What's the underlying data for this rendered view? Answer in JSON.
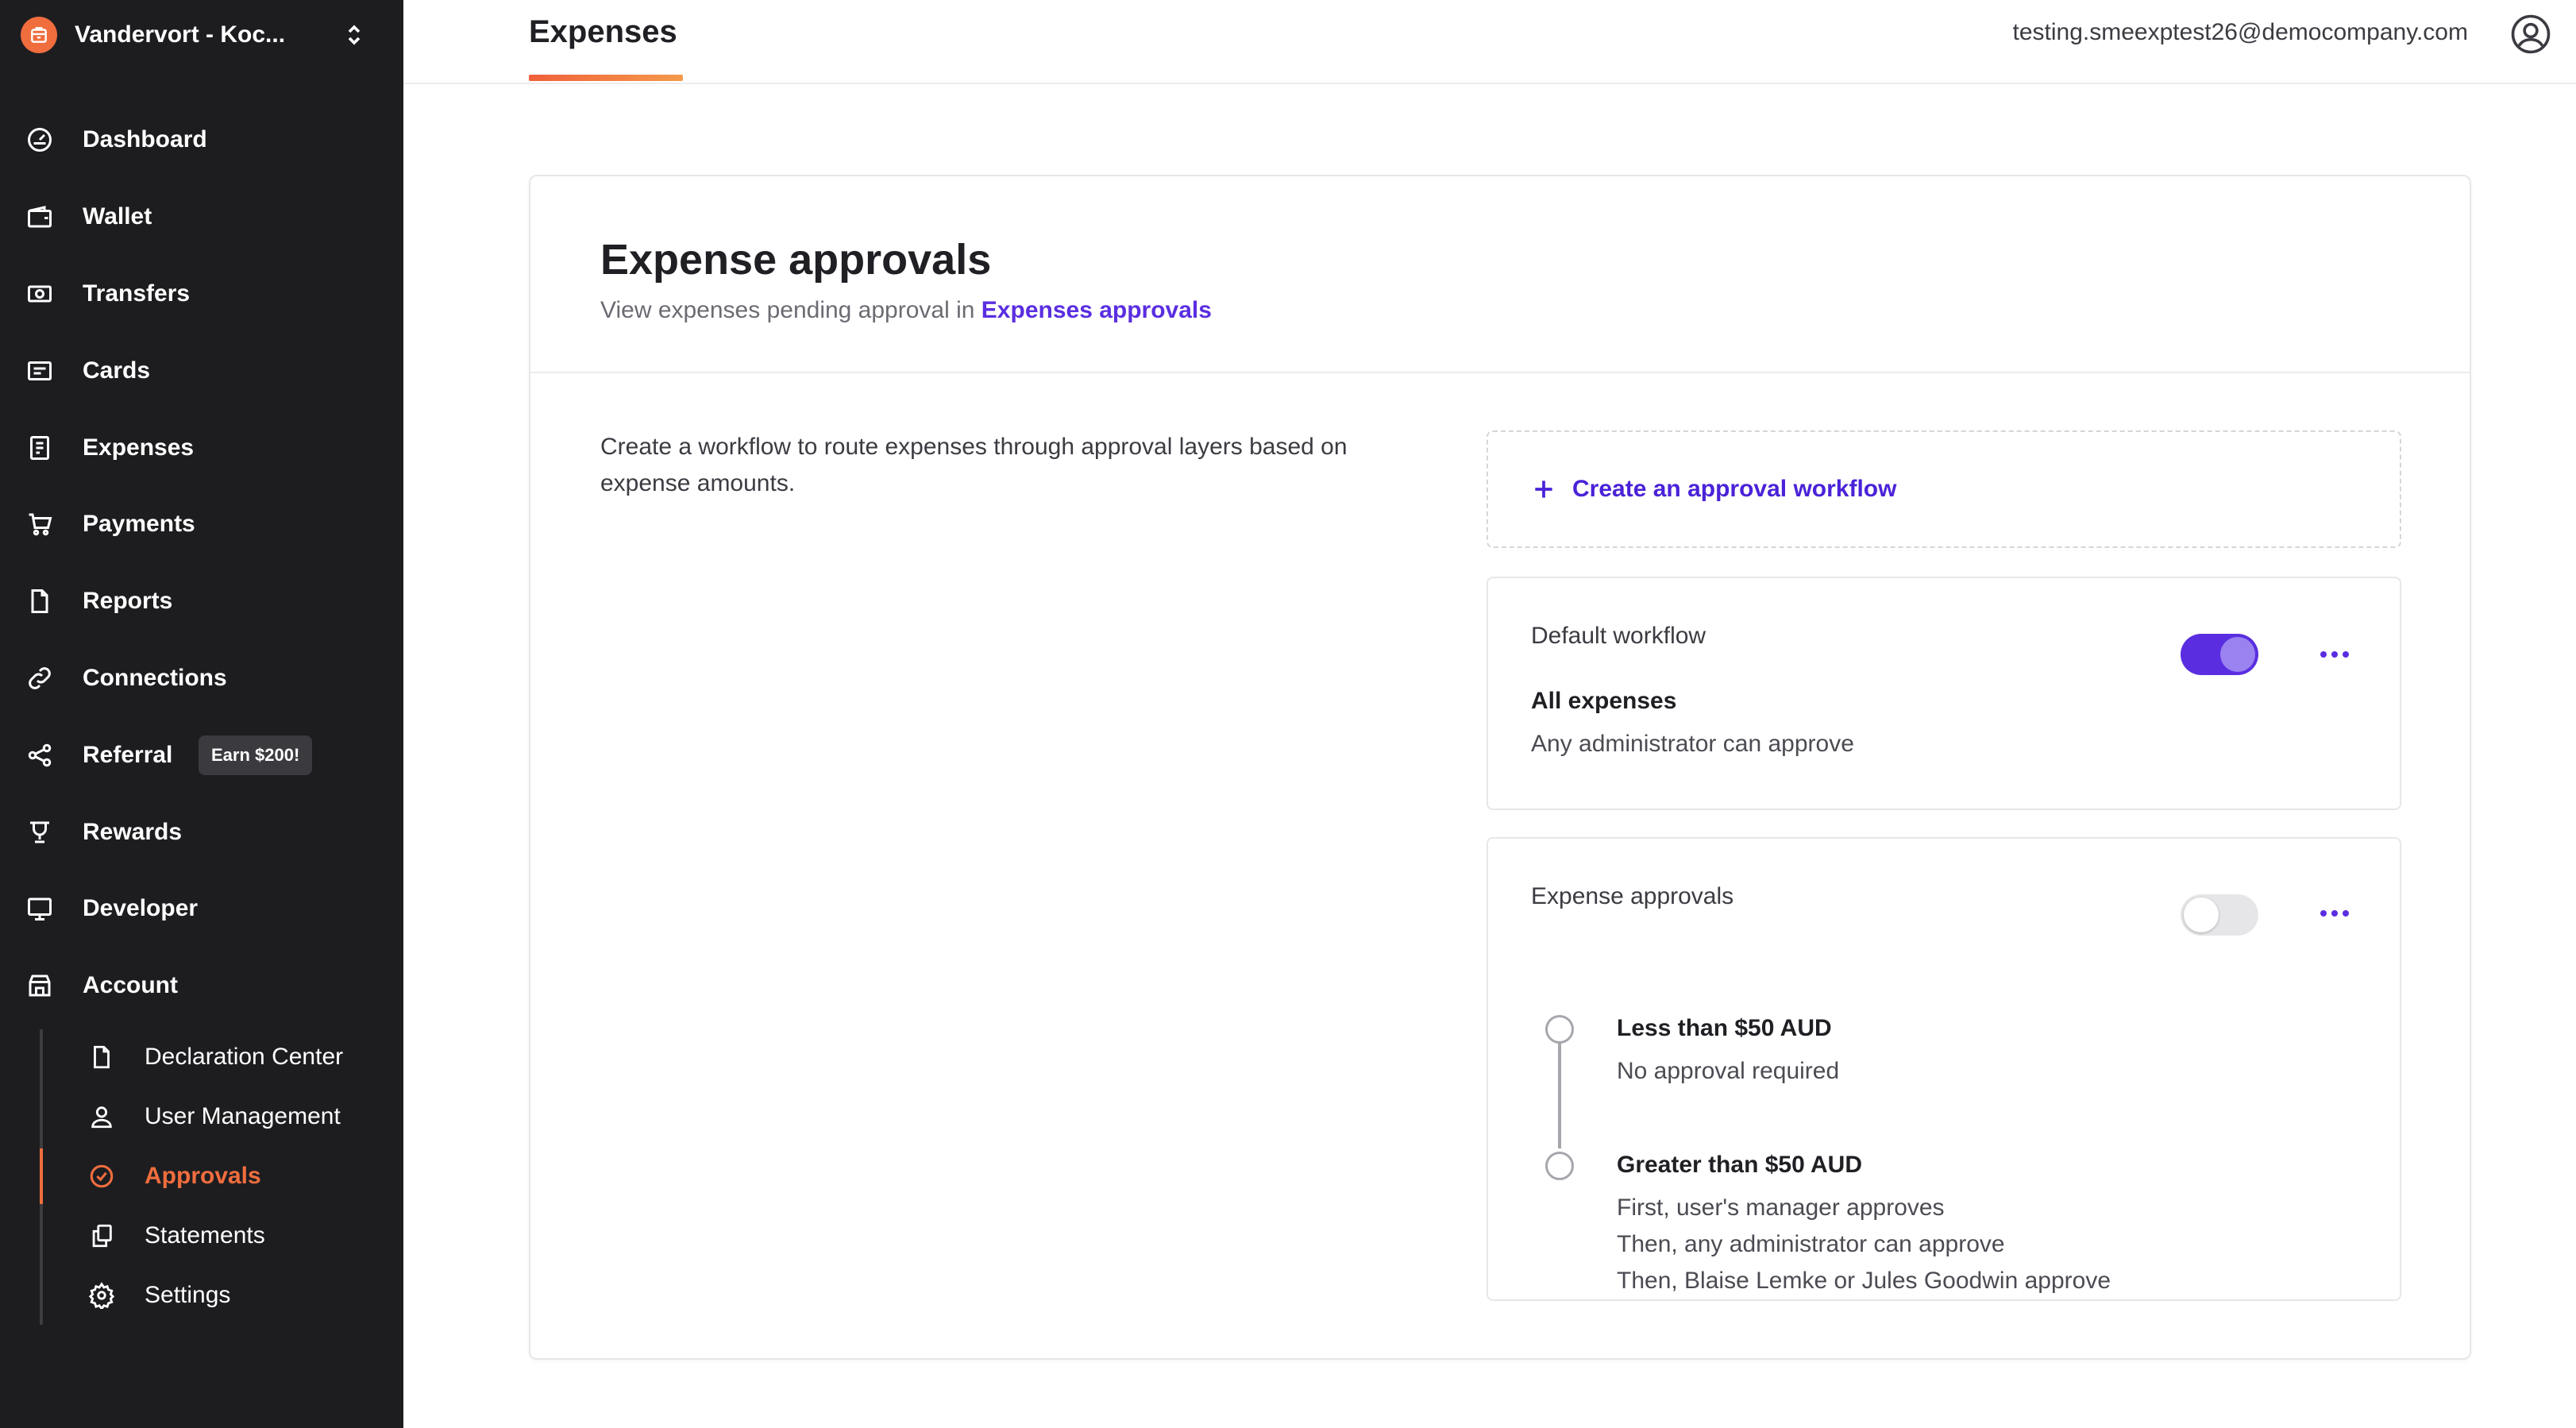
{
  "sidebar": {
    "org_name": "Vandervort - Koc...",
    "nav": [
      {
        "label": "Dashboard",
        "icon": "dashboard-gauge-icon"
      },
      {
        "label": "Wallet",
        "icon": "wallet-icon"
      },
      {
        "label": "Transfers",
        "icon": "transfers-cash-icon"
      },
      {
        "label": "Cards",
        "icon": "card-icon"
      },
      {
        "label": "Expenses",
        "icon": "receipt-icon"
      },
      {
        "label": "Payments",
        "icon": "cart-icon"
      },
      {
        "label": "Reports",
        "icon": "document-icon"
      },
      {
        "label": "Connections",
        "icon": "link-icon"
      },
      {
        "label": "Referral",
        "icon": "share-icon",
        "badge": "Earn $200!"
      },
      {
        "label": "Rewards",
        "icon": "trophy-icon"
      },
      {
        "label": "Developer",
        "icon": "monitor-icon"
      },
      {
        "label": "Account",
        "icon": "store-icon"
      }
    ],
    "account_sub": [
      {
        "label": "Declaration Center",
        "icon": "file-icon"
      },
      {
        "label": "User Management",
        "icon": "user-icon"
      },
      {
        "label": "Approvals",
        "icon": "check-circle-icon",
        "active": true
      },
      {
        "label": "Statements",
        "icon": "copy-icon"
      },
      {
        "label": "Settings",
        "icon": "gear-icon"
      }
    ]
  },
  "header": {
    "tab": "Expenses",
    "email": "testing.smeexptest26@democompany.com"
  },
  "main": {
    "title": "Expense approvals",
    "subtitle_prefix": "View expenses pending approval in",
    "subtitle_link": "Expenses approvals",
    "description": "Create a workflow to route expenses through approval layers based on expense amounts.",
    "create_label": "Create an approval workflow",
    "workflows": [
      {
        "name": "Default workflow",
        "enabled": true,
        "rule_title": "All expenses",
        "rule_text": "Any administrator can approve"
      },
      {
        "name": "Expense approvals",
        "enabled": false,
        "steps": [
          {
            "title": "Less than $50 AUD",
            "lines": [
              "No approval required"
            ]
          },
          {
            "title": "Greater than $50 AUD",
            "lines": [
              "First, user's manager approves",
              "Then, any administrator can approve",
              "Then, Blaise Lemke or Jules Goodwin approve"
            ]
          }
        ]
      }
    ]
  },
  "colors": {
    "sidebar_bg": "#1d1d20",
    "accent_orange": "#f06d3e",
    "accent_purple": "#5a2ee0"
  }
}
